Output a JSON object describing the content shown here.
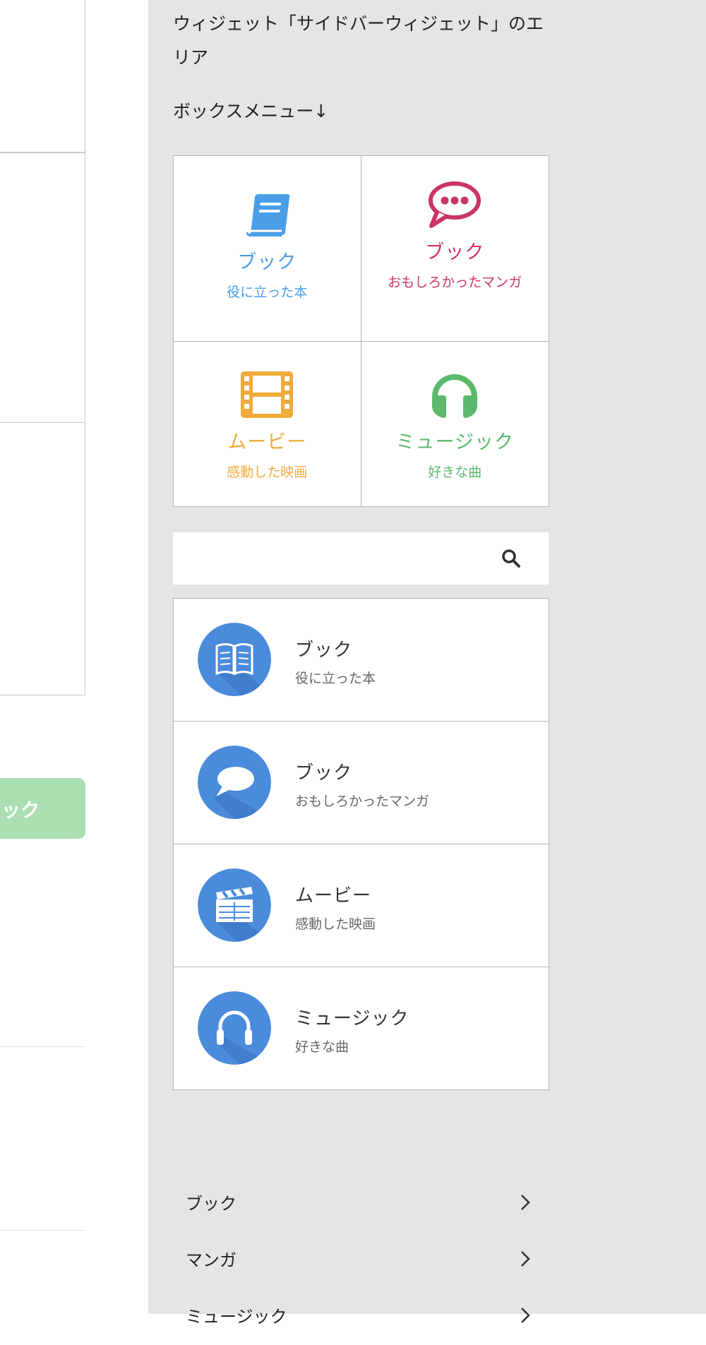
{
  "left": {
    "button_label": "ック"
  },
  "sidebar": {
    "widget_title": "ウィジェット「サイドバーウィジェット」のエリア",
    "box_menu_label": "ボックスメニュー↓",
    "box_menu": [
      {
        "title": "ブック",
        "subtitle": "役に立った本",
        "icon": "book-icon",
        "color": "#4a9ee8"
      },
      {
        "title": "ブック",
        "subtitle": "おもしろかったマンガ",
        "icon": "speech-bubble-icon",
        "color": "#cc3366"
      },
      {
        "title": "ムービー",
        "subtitle": "感動した映画",
        "icon": "film-icon",
        "color": "#f0ab3c"
      },
      {
        "title": "ミュージック",
        "subtitle": "好きな曲",
        "icon": "headphones-icon",
        "color": "#5cb96c"
      }
    ],
    "search": {
      "placeholder": "",
      "icon": "search-icon"
    },
    "list_menu": [
      {
        "title": "ブック",
        "subtitle": "役に立った本",
        "icon": "open-book-icon"
      },
      {
        "title": "ブック",
        "subtitle": "おもしろかったマンガ",
        "icon": "chat-bubble-icon"
      },
      {
        "title": "ムービー",
        "subtitle": "感動した映画",
        "icon": "clapperboard-icon"
      },
      {
        "title": "ミュージック",
        "subtitle": "好きな曲",
        "icon": "headphones-icon"
      }
    ],
    "list_icon_color": "#4a8bdb",
    "categories": [
      {
        "label": "ブック"
      },
      {
        "label": "マンガ"
      },
      {
        "label": "ミュージック"
      }
    ]
  }
}
